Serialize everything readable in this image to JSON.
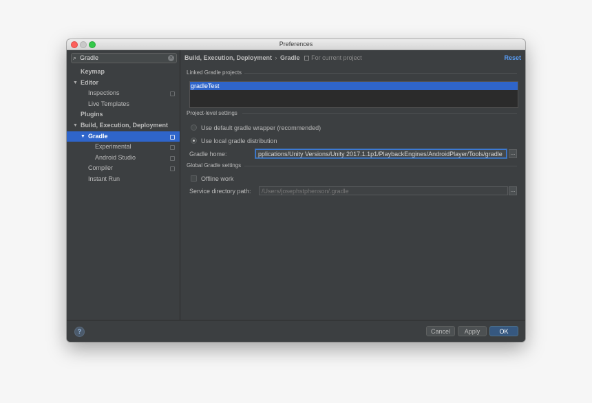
{
  "window": {
    "title": "Preferences"
  },
  "sidebar": {
    "search": {
      "value": "Gradle",
      "icon": "search-icon",
      "clear_icon": "clear-icon"
    },
    "tree": [
      {
        "label": "Keymap",
        "level": 0,
        "bold": true,
        "arrow": "",
        "copy_icon": false,
        "selected": false
      },
      {
        "label": "Editor",
        "level": 0,
        "bold": true,
        "arrow": "▼",
        "copy_icon": false,
        "selected": false
      },
      {
        "label": "Inspections",
        "level": 1,
        "bold": false,
        "arrow": "",
        "copy_icon": true,
        "selected": false
      },
      {
        "label": "Live Templates",
        "level": 1,
        "bold": false,
        "arrow": "",
        "copy_icon": false,
        "selected": false
      },
      {
        "label": "Plugins",
        "level": 0,
        "bold": true,
        "arrow": "",
        "copy_icon": false,
        "selected": false
      },
      {
        "label": "Build, Execution, Deployment",
        "level": 0,
        "bold": true,
        "arrow": "▼",
        "copy_icon": false,
        "selected": false
      },
      {
        "label": "Gradle",
        "level": 1,
        "bold": true,
        "arrow": "▼",
        "copy_icon": true,
        "selected": true
      },
      {
        "label": "Experimental",
        "level": 2,
        "bold": false,
        "arrow": "",
        "copy_icon": true,
        "selected": false
      },
      {
        "label": "Android Studio",
        "level": 2,
        "bold": false,
        "arrow": "",
        "copy_icon": true,
        "selected": false
      },
      {
        "label": "Compiler",
        "level": 1,
        "bold": false,
        "arrow": "",
        "copy_icon": true,
        "selected": false
      },
      {
        "label": "Instant Run",
        "level": 1,
        "bold": false,
        "arrow": "",
        "copy_icon": false,
        "selected": false
      }
    ]
  },
  "content": {
    "breadcrumb": {
      "parent": "Build, Execution, Deployment",
      "separator": "›",
      "current": "Gradle",
      "scope": "For current project"
    },
    "reset_label": "Reset",
    "linked_projects": {
      "title": "Linked Gradle projects",
      "items": [
        "gradleTest"
      ]
    },
    "project_settings": {
      "title": "Project-level settings",
      "options": [
        {
          "label": "Use default gradle wrapper (recommended)",
          "selected": false
        },
        {
          "label": "Use local gradle distribution",
          "selected": true
        }
      ],
      "gradle_home": {
        "label": "Gradle home:",
        "value": "pplications/Unity Versions/Unity 2017.1.1p1/PlaybackEngines/AndroidPlayer/Tools/gradle",
        "browse_label": "..."
      }
    },
    "global_settings": {
      "title": "Global Gradle settings",
      "offline_work": {
        "label": "Offline work",
        "checked": false
      },
      "service_directory": {
        "label": "Service directory path:",
        "value": "/Users/josephstphenson/.gradle",
        "browse_label": "..."
      }
    }
  },
  "footer": {
    "help_label": "?",
    "cancel_label": "Cancel",
    "apply_label": "Apply",
    "ok_label": "OK"
  }
}
